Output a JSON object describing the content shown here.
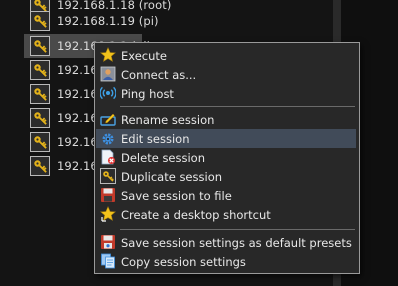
{
  "sessions": [
    {
      "label": "192.168.1.18 (root)"
    },
    {
      "label": "192.168.1.19 (pi)"
    },
    {
      "label": "192.168.1.1 (pi)"
    },
    {
      "label": "192.168.1.1"
    },
    {
      "label": "192.168.1.1"
    },
    {
      "label": "192.168.1.1"
    },
    {
      "label": "192.168.1.1"
    },
    {
      "label": "192.168.1.1"
    }
  ],
  "context_menu": {
    "items": [
      {
        "label": "Execute",
        "icon": "star-icon"
      },
      {
        "label": "Connect as...",
        "icon": "user-icon"
      },
      {
        "label": "Ping host",
        "icon": "ping-icon"
      },
      {
        "label": "Rename session",
        "icon": "rename-icon"
      },
      {
        "label": "Edit session",
        "icon": "gear-icon",
        "highlighted": true
      },
      {
        "label": "Delete session",
        "icon": "delete-icon"
      },
      {
        "label": "Duplicate session",
        "icon": "key-icon"
      },
      {
        "label": "Save session to file",
        "icon": "floppy-icon"
      },
      {
        "label": "Create a desktop shortcut",
        "icon": "star-arrow-icon"
      },
      {
        "label": "Save session settings as default presets",
        "icon": "save-defaults-icon"
      },
      {
        "label": "Copy session settings",
        "icon": "copy-icon"
      }
    ]
  },
  "colors": {
    "background": "#141414",
    "menu_background": "#282828",
    "menu_highlight": "#414b59",
    "key_yellow": "#e3b21a"
  }
}
